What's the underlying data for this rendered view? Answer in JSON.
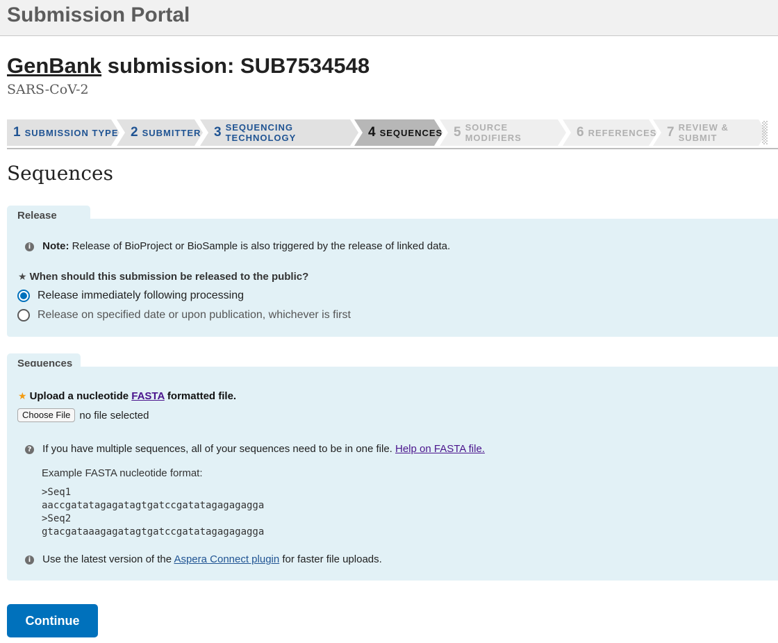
{
  "portal": {
    "title": "Submission Portal"
  },
  "submission": {
    "type_link": "GenBank",
    "title_rest": "submission: SUB7534548",
    "organism": "SARS-CoV-2"
  },
  "steps": [
    {
      "num": "1",
      "label": "SUBMISSION TYPE",
      "state": "done"
    },
    {
      "num": "2",
      "label": "SUBMITTER",
      "state": "done"
    },
    {
      "num": "3",
      "label": "SEQUENCING TECHNOLOGY",
      "state": "done"
    },
    {
      "num": "4",
      "label": "SEQUENCES",
      "state": "current"
    },
    {
      "num": "5",
      "label": "SOURCE MODIFIERS",
      "state": "future"
    },
    {
      "num": "6",
      "label": "REFERENCES",
      "state": "future"
    },
    {
      "num": "7",
      "label": "REVIEW & SUBMIT",
      "state": "future"
    }
  ],
  "page": {
    "heading": "Sequences"
  },
  "release": {
    "tab": "Release date",
    "note_label": "Note:",
    "note_text": " Release of BioProject or BioSample is also triggered by the release of linked data.",
    "question": "When should this submission be released to the public?",
    "options": [
      {
        "label": "Release immediately following processing",
        "selected": true
      },
      {
        "label": "Release on specified date or upon publication, whichever is first",
        "selected": false
      }
    ]
  },
  "sequences": {
    "tab": "Sequences",
    "upload_pre": "Upload a nucleotide ",
    "upload_link": "FASTA",
    "upload_post": " formatted file.",
    "choose_file": "Choose File",
    "file_status": "no file selected",
    "help_text": "If you have multiple sequences, all of your sequences need to be in one file. ",
    "help_link": "Help on FASTA file.",
    "example_label": "Example FASTA nucleotide format:",
    "example_lines": [
      ">Seq1",
      "aaccgatatagagatagtgatccgatatagagagagga",
      ">Seq2",
      "gtacgataaagagatagtgatccgatatagagagagga"
    ],
    "aspera_pre": "Use the latest version of the ",
    "aspera_link": "Aspera Connect plugin",
    "aspera_post": " for faster file uploads."
  },
  "actions": {
    "continue": "Continue"
  },
  "colors": {
    "accent": "#0071bc",
    "panel": "#e2f1f6",
    "step_done": "#205493"
  }
}
